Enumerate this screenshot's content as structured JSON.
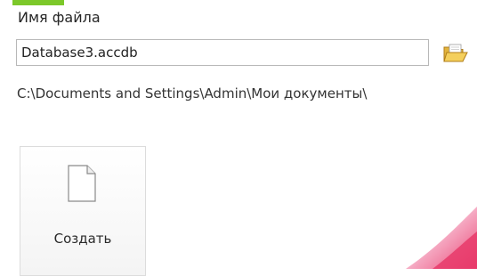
{
  "colors": {
    "accent": "#7cc82a",
    "swoosh": "#e83a6a"
  },
  "file": {
    "label": "Имя файла",
    "value": "Database3.accdb",
    "browse_icon": "open-folder-icon",
    "path": "C:\\Documents and Settings\\Admin\\Мои документы\\"
  },
  "actions": {
    "create_label": "Создать",
    "create_icon": "blank-document-icon"
  }
}
